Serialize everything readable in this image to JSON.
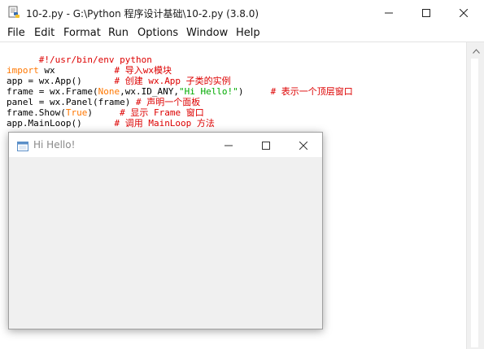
{
  "editor_window": {
    "title": "10-2.py - G:\\Python 程序设计基础\\10-2.py (3.8.0)",
    "icon": "python-idle-icon",
    "controls": {
      "minimize": "minimize-icon",
      "maximize": "maximize-icon",
      "close": "close-icon"
    }
  },
  "menu": [
    {
      "label": "File"
    },
    {
      "label": "Edit"
    },
    {
      "label": "Format"
    },
    {
      "label": "Run"
    },
    {
      "label": "Options"
    },
    {
      "label": "Window"
    },
    {
      "label": "Help"
    }
  ],
  "code": {
    "line1": {
      "a": "#!/usr/bin/env python"
    },
    "line2": {
      "kw": "import",
      "a": " wx           ",
      "c": "# 导入wx模块"
    },
    "line3": {
      "a": "app = wx.App()      ",
      "c": "# 创建 wx.App 子类的实例"
    },
    "line4": {
      "a": "frame = wx.Frame(",
      "kw": "None",
      "b": ",wx.ID_ANY,",
      "s": "\"Hi Hello!\"",
      "d": ")     ",
      "c": "# 表示一个顶层窗口"
    },
    "line5": {
      "a": "panel = wx.Panel(frame) ",
      "c": "# 声明一个面板"
    },
    "line6": {
      "a": "frame.Show(",
      "kw": "True",
      "b": ")     ",
      "c": "# 显示 Frame 窗口"
    },
    "line7": {
      "a": "app.MainLoop()      ",
      "c": "# 调用 MainLoop 方法"
    }
  },
  "frame_window": {
    "title": "Hi Hello!",
    "icon": "wx-frame-icon",
    "controls": {
      "minimize": "minimize-icon",
      "maximize": "maximize-icon",
      "close": "close-icon"
    }
  },
  "colors": {
    "keyword": "#ff7700",
    "comment": "#dd0000",
    "string": "#00aa00",
    "frame_background": "#f0f0f0"
  }
}
